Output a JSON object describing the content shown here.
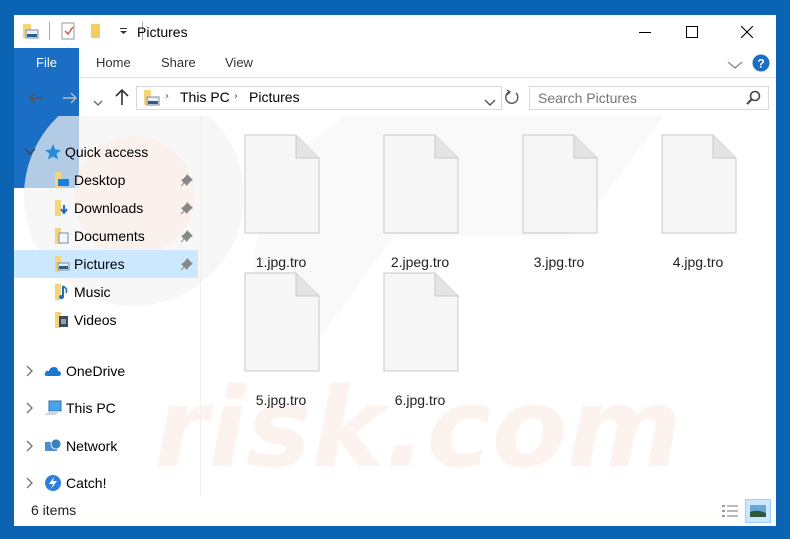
{
  "window": {
    "title": "Pictures",
    "controls": {
      "minimize": "minimize-icon",
      "maximize": "maximize-icon",
      "close": "close-icon"
    },
    "frame_color": "#0b63b3"
  },
  "ribbon": {
    "tabs": [
      {
        "label": "File"
      },
      {
        "label": "Home"
      },
      {
        "label": "Share"
      },
      {
        "label": "View"
      }
    ],
    "accent": "#1a6fc4"
  },
  "navigation": {
    "breadcrumb": [
      "This PC",
      "Pictures"
    ],
    "search_placeholder": "Search Pictures"
  },
  "sidebar": {
    "quick_access": {
      "label": "Quick access",
      "items": [
        {
          "label": "Desktop",
          "pinned": true
        },
        {
          "label": "Downloads",
          "pinned": true
        },
        {
          "label": "Documents",
          "pinned": true
        },
        {
          "label": "Pictures",
          "pinned": true,
          "selected": true
        },
        {
          "label": "Music",
          "pinned": false
        },
        {
          "label": "Videos",
          "pinned": false
        }
      ]
    },
    "roots": [
      {
        "label": "OneDrive"
      },
      {
        "label": "This PC"
      },
      {
        "label": "Network"
      },
      {
        "label": "Catch!"
      }
    ]
  },
  "files": [
    {
      "name": "1.jpg.tro"
    },
    {
      "name": "2.jpeg.tro"
    },
    {
      "name": "3.jpg.tro"
    },
    {
      "name": "4.jpg.tro"
    },
    {
      "name": "5.jpg.tro"
    },
    {
      "name": "6.jpg.tro"
    }
  ],
  "status": {
    "item_count": "6 items"
  }
}
